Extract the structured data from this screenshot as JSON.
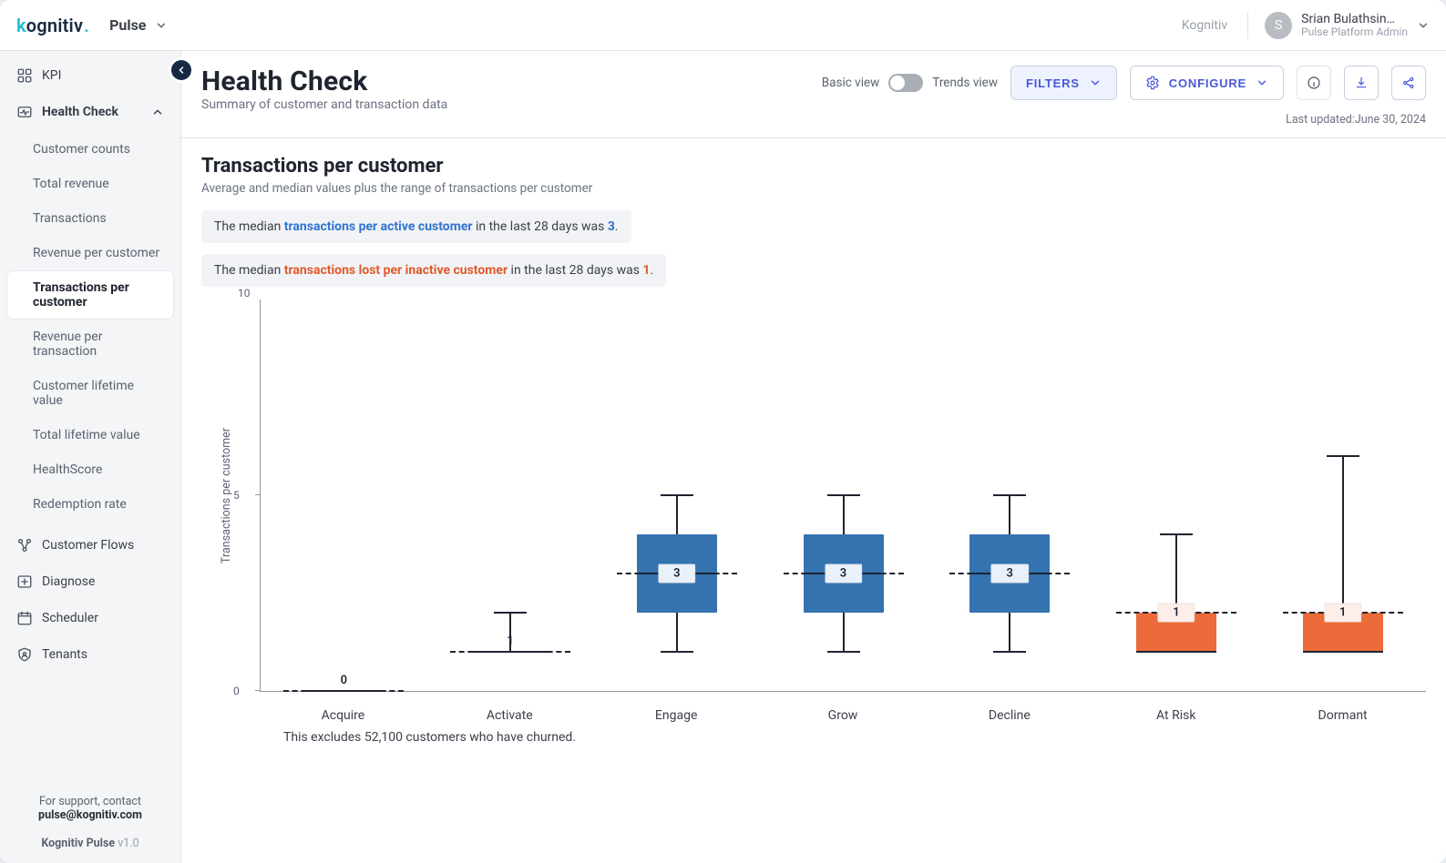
{
  "brand": {
    "logo_k": "k",
    "logo_rest": "ognitiv",
    "logo_dot": "."
  },
  "app_switch": {
    "label": "Pulse"
  },
  "tenant": "Kognitiv",
  "user": {
    "initial": "S",
    "name": "Srian Bulathsin…",
    "role": "Pulse Platform Admin"
  },
  "sidebar": {
    "kpi": "KPI",
    "health_check": "Health Check",
    "subs": [
      "Customer counts",
      "Total revenue",
      "Transactions",
      "Revenue per customer",
      "Transactions per customer",
      "Revenue per transaction",
      "Customer lifetime value",
      "Total lifetime value",
      "HealthScore",
      "Redemption rate"
    ],
    "active_index": 4,
    "customer_flows": "Customer Flows",
    "diagnose": "Diagnose",
    "scheduler": "Scheduler",
    "tenants": "Tenants",
    "support_line": "For support, contact",
    "support_email": "pulse@kognitiv.com",
    "product": "Kognitiv Pulse ",
    "version": "v1.0"
  },
  "page": {
    "title": "Health Check",
    "subtitle": "Summary of customer and transaction data",
    "basic_view": "Basic view",
    "trends_view": "Trends view",
    "filters": "FILTERS",
    "configure": "CONFIGURE",
    "last_updated_label": "Last updated: ",
    "last_updated_value": "June 30, 2024"
  },
  "section": {
    "title": "Transactions per customer",
    "subtitle": "Average and median values plus the range of transactions per customer"
  },
  "callouts": {
    "a_pre": "The median ",
    "a_link": "transactions per active customer",
    "a_mid": " in the last 28 days was ",
    "a_val": "3",
    "a_end": ".",
    "b_pre": "The median ",
    "b_link": "transactions lost per inactive customer",
    "b_mid": " in the last 28 days was ",
    "b_val": "1",
    "b_end": "."
  },
  "footnote": "This excludes 52,100 customers who have churned.",
  "chart_data": {
    "type": "box",
    "ylabel": "Transactions per customer",
    "ylim": [
      0,
      10
    ],
    "yticks": [
      0,
      5,
      10
    ],
    "categories": [
      "Acquire",
      "Activate",
      "Engage",
      "Grow",
      "Decline",
      "At Risk",
      "Dormant"
    ],
    "series": [
      {
        "name": "Acquire",
        "color": "none",
        "min": 0,
        "q1": 0,
        "median": 0,
        "q3": 0,
        "max": 0,
        "mean": 0,
        "mean_label": "0"
      },
      {
        "name": "Activate",
        "color": "none",
        "min": 1,
        "q1": 1,
        "median": 1,
        "q3": 1,
        "max": 2,
        "mean": 1,
        "mean_label": "1"
      },
      {
        "name": "Engage",
        "color": "blue",
        "min": 1,
        "q1": 2,
        "median": 3,
        "q3": 4,
        "max": 5,
        "mean": 3,
        "mean_label": "3"
      },
      {
        "name": "Grow",
        "color": "blue",
        "min": 1,
        "q1": 2,
        "median": 3,
        "q3": 4,
        "max": 5,
        "mean": 3,
        "mean_label": "3"
      },
      {
        "name": "Decline",
        "color": "blue",
        "min": 1,
        "q1": 2,
        "median": 3,
        "q3": 4,
        "max": 5,
        "mean": 3,
        "mean_label": "3"
      },
      {
        "name": "At Risk",
        "color": "orange",
        "min": 1,
        "q1": 1,
        "median": 1,
        "q3": 2,
        "max": 4,
        "mean": 2,
        "mean_label": "1"
      },
      {
        "name": "Dormant",
        "color": "orange",
        "min": 1,
        "q1": 1,
        "median": 1,
        "q3": 2,
        "max": 6,
        "mean": 2,
        "mean_label": "1"
      }
    ]
  }
}
